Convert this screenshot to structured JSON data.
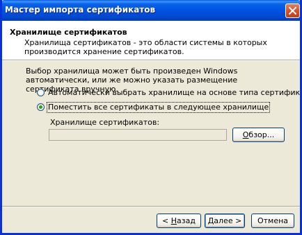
{
  "window": {
    "title": "Мастер импорта сертификатов",
    "close_icon": "close-icon"
  },
  "header": {
    "title": "Хранилище сертификатов",
    "description": "Хранилища сертификатов - это области системы в которых производится хранение сертификатов."
  },
  "body": {
    "intro": "Выбор хранилища может быть произведен Windows автоматически, или же можно указать размещение сертификата вручную.",
    "options": [
      {
        "label": "Автоматически выбрать хранилище на основе типа сертификата",
        "selected": false
      },
      {
        "label": "Поместить все сертификаты в следующее хранилище",
        "selected": true
      }
    ],
    "store_label": "Хранилище сертификатов:",
    "store_value": "",
    "browse": {
      "prefix": "",
      "accel": "О",
      "rest": "бзор..."
    }
  },
  "footer": {
    "back": {
      "prefix": "< ",
      "accel": "Н",
      "rest": "азад"
    },
    "next": {
      "prefix": "",
      "accel": "Д",
      "rest": "алее >"
    },
    "cancel": "Отмена"
  },
  "colors": {
    "titlebar": "#0055e5",
    "window_bg": "#ece9d8",
    "radio_dot": "#21a121"
  }
}
